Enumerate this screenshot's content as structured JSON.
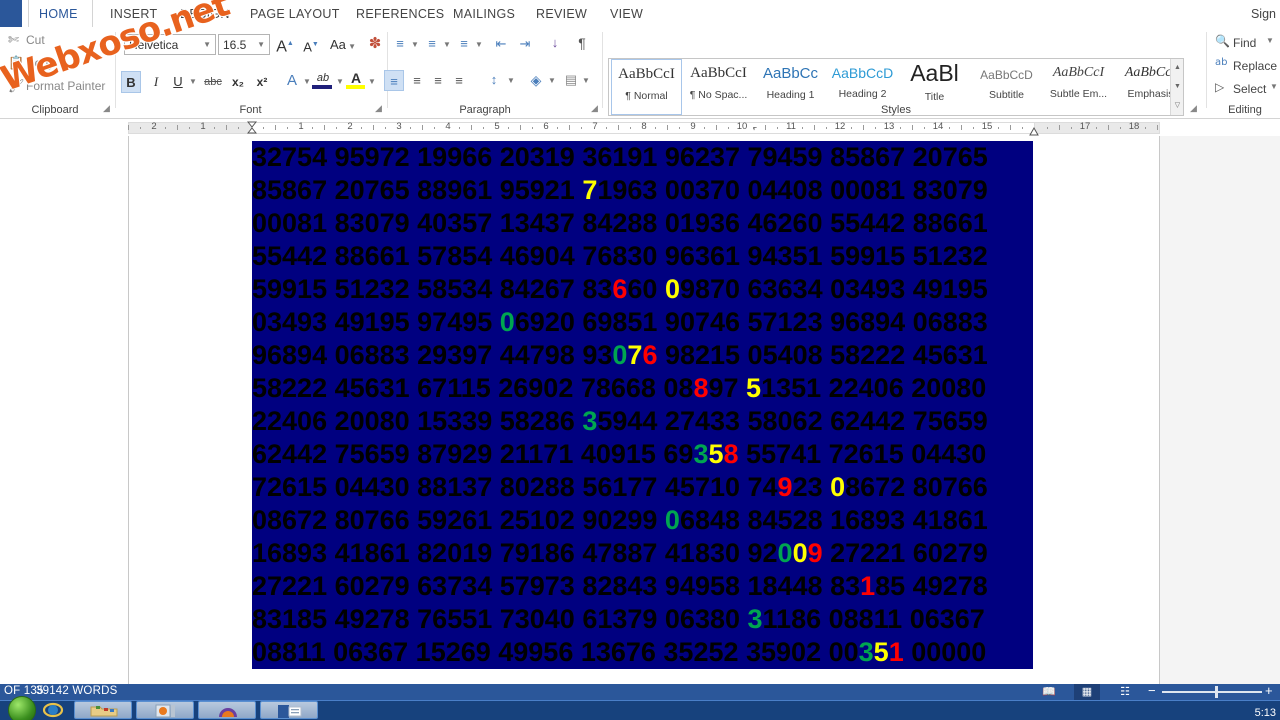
{
  "window": {
    "accent_color": "#2b579a",
    "top_rule_color": "#c0392b",
    "watermark": "Webxoso.net"
  },
  "ribbon": {
    "tabs": [
      {
        "label": "HOME",
        "active": true
      },
      {
        "label": "INSERT",
        "active": false
      },
      {
        "label": "DESIGN",
        "active": false
      },
      {
        "label": "PAGE LAYOUT",
        "active": false
      },
      {
        "label": "REFERENCES",
        "active": false
      },
      {
        "label": "MAILINGS",
        "active": false
      },
      {
        "label": "REVIEW",
        "active": false
      },
      {
        "label": "VIEW",
        "active": false
      }
    ],
    "signin": "Sign",
    "groups": [
      {
        "label": "Clipboard"
      },
      {
        "label": "Font"
      },
      {
        "label": "Paragraph"
      },
      {
        "label": "Styles"
      },
      {
        "label": "Editing"
      }
    ],
    "clipboard": {
      "cut": "Cut",
      "copy": "Copy",
      "format_painter": "Format Painter"
    },
    "font": {
      "name_value": "Helvetica",
      "size_value": "16.5",
      "grow_font": "A",
      "shrink_font": "A",
      "change_case": "Aa",
      "clear_formatting": "clear-formatting",
      "bold": "B",
      "italic": "I",
      "underline": "U",
      "strikethrough": "abc",
      "subscript": "x₂",
      "superscript": "x²",
      "text_effects": "A",
      "highlight": "ab",
      "font_color": "A",
      "highlight_color": "#ffff00",
      "font_color_swatch": "#1f1f7a",
      "bold_active": true
    },
    "paragraph": {
      "bullets": "bullets-icon",
      "numbering": "numbering-icon",
      "multilevel": "multilevel-list-icon",
      "decrease_indent": "decrease-indent-icon",
      "increase_indent": "increase-indent-icon",
      "sort": "sort-icon",
      "show_marks": "¶",
      "align_left": "align-left-icon",
      "align_center": "align-center-icon",
      "align_right": "align-right-icon",
      "justify": "justify-icon",
      "line_spacing": "line-spacing-icon",
      "shading": "shading-icon",
      "borders": "borders-icon",
      "align_left_active": true
    },
    "styles": [
      {
        "preview": "AaBbCcI",
        "name": "¶ Normal",
        "selected": true,
        "color": "#333333",
        "font": "serif",
        "size": 15
      },
      {
        "preview": "AaBbCcI",
        "name": "¶ No Spac...",
        "selected": false,
        "color": "#333333",
        "font": "serif",
        "size": 15
      },
      {
        "preview": "AaBbCc",
        "name": "Heading 1",
        "selected": false,
        "color": "#2e74b5",
        "font": "sans",
        "size": 15
      },
      {
        "preview": "AaBbCcD",
        "name": "Heading 2",
        "selected": false,
        "color": "#2e9bd5",
        "font": "sans",
        "size": 14
      },
      {
        "preview": "AaBl",
        "name": "Title",
        "selected": false,
        "color": "#222222",
        "font": "sans",
        "size": 23
      },
      {
        "preview": "AaBbCcD",
        "name": "Subtitle",
        "selected": false,
        "color": "#777777",
        "font": "sans",
        "size": 12
      },
      {
        "preview": "AaBbCcI",
        "name": "Subtle Em...",
        "selected": false,
        "color": "#444444",
        "font": "serifi",
        "size": 14
      },
      {
        "preview": "AaBbCcI",
        "name": "Emphasis",
        "selected": false,
        "color": "#333333",
        "font": "serifi",
        "size": 14
      }
    ],
    "editing": {
      "find": "Find",
      "replace": "Replace",
      "select": "Select"
    }
  },
  "ruler": {
    "left_numbers": [
      "2",
      "1"
    ],
    "right_numbers": [
      "1",
      "2",
      "3",
      "4",
      "5",
      "6",
      "7",
      "8",
      "9",
      "10",
      "11",
      "12",
      "13",
      "14",
      "15",
      "17",
      "18"
    ]
  },
  "document": {
    "selection_bg": "#000080",
    "text_color": "#000000",
    "colors": {
      "red": "#ff0000",
      "yellow": "#ffff00",
      "green": "#00a550"
    },
    "lines": [
      [
        {
          "t": "32754 95972 19966 20319 36191 96237 79459 85867 20765",
          "c": "k"
        }
      ],
      [
        {
          "t": "85867 20765 88961 95921 ",
          "c": "k"
        },
        {
          "t": "7",
          "c": "y"
        },
        {
          "t": "1963 00370 04408 00081 83079",
          "c": "k"
        }
      ],
      [
        {
          "t": "00081 83079 40357 13437 84288 01936 46260 55442 88661",
          "c": "k"
        }
      ],
      [
        {
          "t": "55442 88661 57854 46904 76830 96361 94351 59915 51232",
          "c": "k"
        }
      ],
      [
        {
          "t": "59915 51232 58534 84267 83",
          "c": "k"
        },
        {
          "t": "6",
          "c": "r"
        },
        {
          "t": "60 ",
          "c": "k"
        },
        {
          "t": "0",
          "c": "y"
        },
        {
          "t": "9870 63634 03493 49195",
          "c": "k"
        }
      ],
      [
        {
          "t": "03493 49195 97495 ",
          "c": "k"
        },
        {
          "t": "0",
          "c": "g"
        },
        {
          "t": "6920 69851 90746 57123 96894 06883",
          "c": "k"
        }
      ],
      [
        {
          "t": "96894 06883 29397 44798 93",
          "c": "k"
        },
        {
          "t": "0",
          "c": "g"
        },
        {
          "t": "7",
          "c": "y"
        },
        {
          "t": "6",
          "c": "r"
        },
        {
          "t": " 98215 05408 58222 45631",
          "c": "k"
        }
      ],
      [
        {
          "t": "58222 45631 67115 26902 78668 08",
          "c": "k"
        },
        {
          "t": "8",
          "c": "r"
        },
        {
          "t": "97 ",
          "c": "k"
        },
        {
          "t": "5",
          "c": "y"
        },
        {
          "t": "1351 22406 20080",
          "c": "k"
        }
      ],
      [
        {
          "t": "22406 20080 15339 58286 ",
          "c": "k"
        },
        {
          "t": "3",
          "c": "g"
        },
        {
          "t": "5944 27433 58062 62442 75659",
          "c": "k"
        }
      ],
      [
        {
          "t": "62442 75659 87929 21171 40915 69",
          "c": "k"
        },
        {
          "t": "3",
          "c": "g"
        },
        {
          "t": "5",
          "c": "y"
        },
        {
          "t": "8",
          "c": "r"
        },
        {
          "t": " 55741 72615 04430",
          "c": "k"
        }
      ],
      [
        {
          "t": "72615 04430 88137 80288 56177 45710 74",
          "c": "k"
        },
        {
          "t": "9",
          "c": "r"
        },
        {
          "t": "23 ",
          "c": "k"
        },
        {
          "t": "0",
          "c": "y"
        },
        {
          "t": "8672 80766",
          "c": "k"
        }
      ],
      [
        {
          "t": "08672 80766 59261 25102 90299 ",
          "c": "k"
        },
        {
          "t": "0",
          "c": "g"
        },
        {
          "t": "6848 84528 16893 41861",
          "c": "k"
        }
      ],
      [
        {
          "t": "16893 41861 82019 79186 47887 41830 92",
          "c": "k"
        },
        {
          "t": "0",
          "c": "g"
        },
        {
          "t": "0",
          "c": "y"
        },
        {
          "t": "9",
          "c": "r"
        },
        {
          "t": " 27221 60279",
          "c": "k"
        }
      ],
      [
        {
          "t": "27221 60279 63734 57973 82843 94958 18448 83",
          "c": "k"
        },
        {
          "t": "1",
          "c": "r"
        },
        {
          "t": "85 49278",
          "c": "k"
        }
      ],
      [
        {
          "t": "83185 49278 76551 73040 61379 06380 ",
          "c": "k"
        },
        {
          "t": "3",
          "c": "g"
        },
        {
          "t": "1186 08811 06367",
          "c": "k"
        }
      ],
      [
        {
          "t": "08811 06367 15269 49956 13676 35252 35902 00",
          "c": "k"
        },
        {
          "t": "3",
          "c": "g"
        },
        {
          "t": "5",
          "c": "y"
        },
        {
          "t": "1",
          "c": "r"
        },
        {
          "t": " 00000",
          "c": "k"
        }
      ]
    ]
  },
  "status": {
    "page_of": "OF 135",
    "word_count": "39142 WORDS",
    "view_read": "read-mode-icon",
    "view_print": "print-layout-icon",
    "view_web": "web-layout-icon",
    "zoom_minus": "−",
    "zoom_plus": "+"
  },
  "taskbar": {
    "start": "start-orb",
    "items": [
      "internet-explorer-icon",
      "folder-icon",
      "media-icon",
      "player-icon",
      "word-icon"
    ],
    "clock": "5:13"
  }
}
